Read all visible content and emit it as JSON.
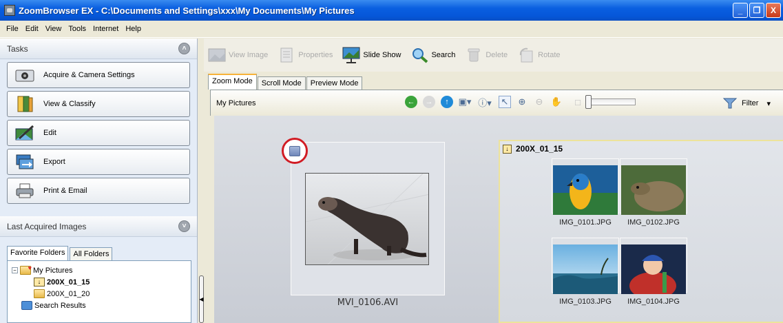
{
  "window": {
    "title": "ZoomBrowser EX  -  C:\\Documents and Settings\\xxx\\My Documents\\My Pictures",
    "minimize": "_",
    "maximize": "❐",
    "close": "X"
  },
  "menu": [
    "File",
    "Edit",
    "View",
    "Tools",
    "Internet",
    "Help"
  ],
  "tasks": {
    "header": "Tasks",
    "items": [
      "Acquire & Camera Settings",
      "View & Classify",
      "Edit",
      "Export",
      "Print & Email"
    ]
  },
  "last_acquired": {
    "header": "Last Acquired Images"
  },
  "folders": {
    "tabs": [
      "Favorite Folders",
      "All Folders"
    ],
    "tree": [
      "My Pictures",
      "200X_01_15",
      "200X_01_20",
      "Search Results"
    ]
  },
  "toolbar": {
    "view_image": "View Image",
    "properties": "Properties",
    "slide_show": "Slide Show",
    "search": "Search",
    "delete": "Delete",
    "rotate": "Rotate"
  },
  "mode_tabs": [
    "Zoom Mode",
    "Scroll Mode",
    "Preview Mode"
  ],
  "breadcrumb": "My Pictures",
  "filter_label": "Filter",
  "browser": {
    "video_caption": "MVI_0106.AVI",
    "group_title": "200X_01_15",
    "images": [
      "IMG_0101.JPG",
      "IMG_0102.JPG",
      "IMG_0103.JPG",
      "IMG_0104.JPG"
    ]
  }
}
